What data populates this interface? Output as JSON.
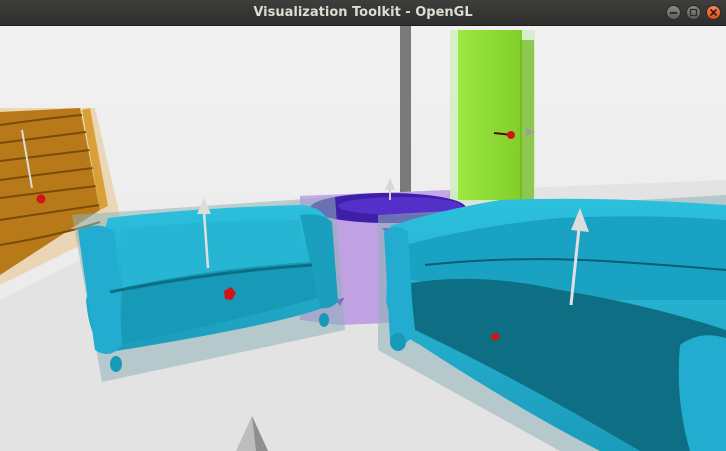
{
  "window": {
    "title": "Visualization Toolkit - OpenGL",
    "controls": [
      "minimize",
      "maximize",
      "close"
    ]
  },
  "scene": {
    "objects": [
      "bookshelf-object",
      "armchair-sofa-object",
      "side-table-object",
      "large-sofa-object",
      "green-box-object",
      "gray-pole-object"
    ],
    "colors": {
      "floor": "#e6e6e6",
      "wall": "#efefef",
      "sofa": "#1fa9c9",
      "sofa_dark": "#0e6e84",
      "bbox": "#8fb3b8",
      "bookshelf": "#b87a18",
      "table_box": "#b48be0",
      "table_top": "#3d1fa8",
      "green_box": "#8fe02a",
      "pole": "#7a7a7a",
      "arrow": "#d4d4d4",
      "marker": "#d31414"
    }
  }
}
